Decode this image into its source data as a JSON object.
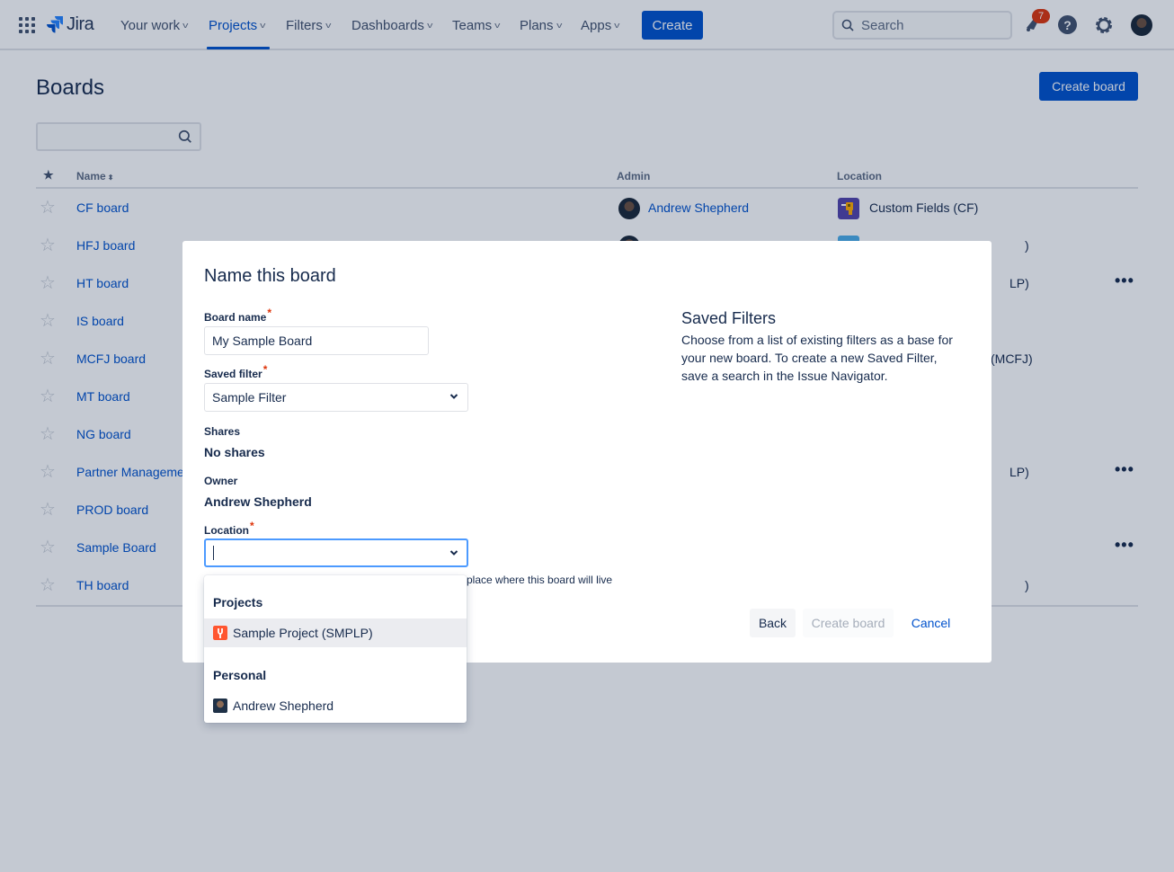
{
  "topnav": {
    "logo_text": "Jira",
    "items": [
      {
        "label": "Your work"
      },
      {
        "label": "Projects",
        "active": true
      },
      {
        "label": "Filters"
      },
      {
        "label": "Dashboards"
      },
      {
        "label": "Teams"
      },
      {
        "label": "Plans"
      },
      {
        "label": "Apps"
      }
    ],
    "create_label": "Create",
    "search_placeholder": "Search",
    "notification_count": "7",
    "help_glyph": "?",
    "accent_color": "#0052cc"
  },
  "page": {
    "title": "Boards",
    "create_board_label": "Create board",
    "filter_placeholder": "",
    "table": {
      "columns": {
        "star": "★",
        "name": "Name",
        "sort_glyph": "⬍",
        "admin": "Admin",
        "location": "Location"
      },
      "rows": [
        {
          "name": "CF board",
          "admin": "Andrew Shepherd",
          "location": "Custom Fields (CF)",
          "more": false
        },
        {
          "name": "HFJ board",
          "admin": "",
          "location": ")",
          "more": false
        },
        {
          "name": "HT board",
          "admin": "",
          "location": "LP)",
          "more": true
        },
        {
          "name": "IS board",
          "admin": "",
          "location": "",
          "more": false
        },
        {
          "name": "MCFJ board",
          "admin": "",
          "location": "(MCFJ)",
          "more": false
        },
        {
          "name": "MT board",
          "admin": "",
          "location": "",
          "more": false
        },
        {
          "name": "NG board",
          "admin": "",
          "location": "",
          "more": false
        },
        {
          "name": "Partner Manageme",
          "admin": "",
          "location": "LP)",
          "more": true
        },
        {
          "name": "PROD board",
          "admin": "",
          "location": "",
          "more": false
        },
        {
          "name": "Sample Board",
          "admin": "",
          "location": "",
          "more": true
        },
        {
          "name": "TH board",
          "admin": "",
          "location": ")",
          "more": false
        }
      ],
      "more_glyph": "•••",
      "star_glyph": "☆"
    }
  },
  "modal": {
    "title": "Name this board",
    "board_name_label": "Board name",
    "board_name_value": "My Sample Board",
    "saved_filter_label": "Saved filter",
    "saved_filter_value": "Sample Filter",
    "shares_label": "Shares",
    "shares_value": "No shares",
    "owner_label": "Owner",
    "owner_value": "Andrew Shepherd",
    "location_label": "Location",
    "location_value": "",
    "location_help": "place where this board will live",
    "required_mark": "*",
    "chevron": "⌄",
    "side_title": "Saved Filters",
    "side_body": "Choose from a list of existing filters as a base for your new board. To create a new Saved Filter, save a search in the Issue Navigator.",
    "back_label": "Back",
    "create_label": "Create board",
    "cancel_label": "Cancel"
  },
  "location_dropdown": {
    "groups": [
      {
        "heading": "Projects",
        "options": [
          {
            "label": "Sample Project (SMPLP)",
            "highlighted": true
          }
        ]
      },
      {
        "heading": "Personal",
        "options": [
          {
            "label": "Andrew Shepherd",
            "highlighted": false
          }
        ]
      }
    ]
  }
}
